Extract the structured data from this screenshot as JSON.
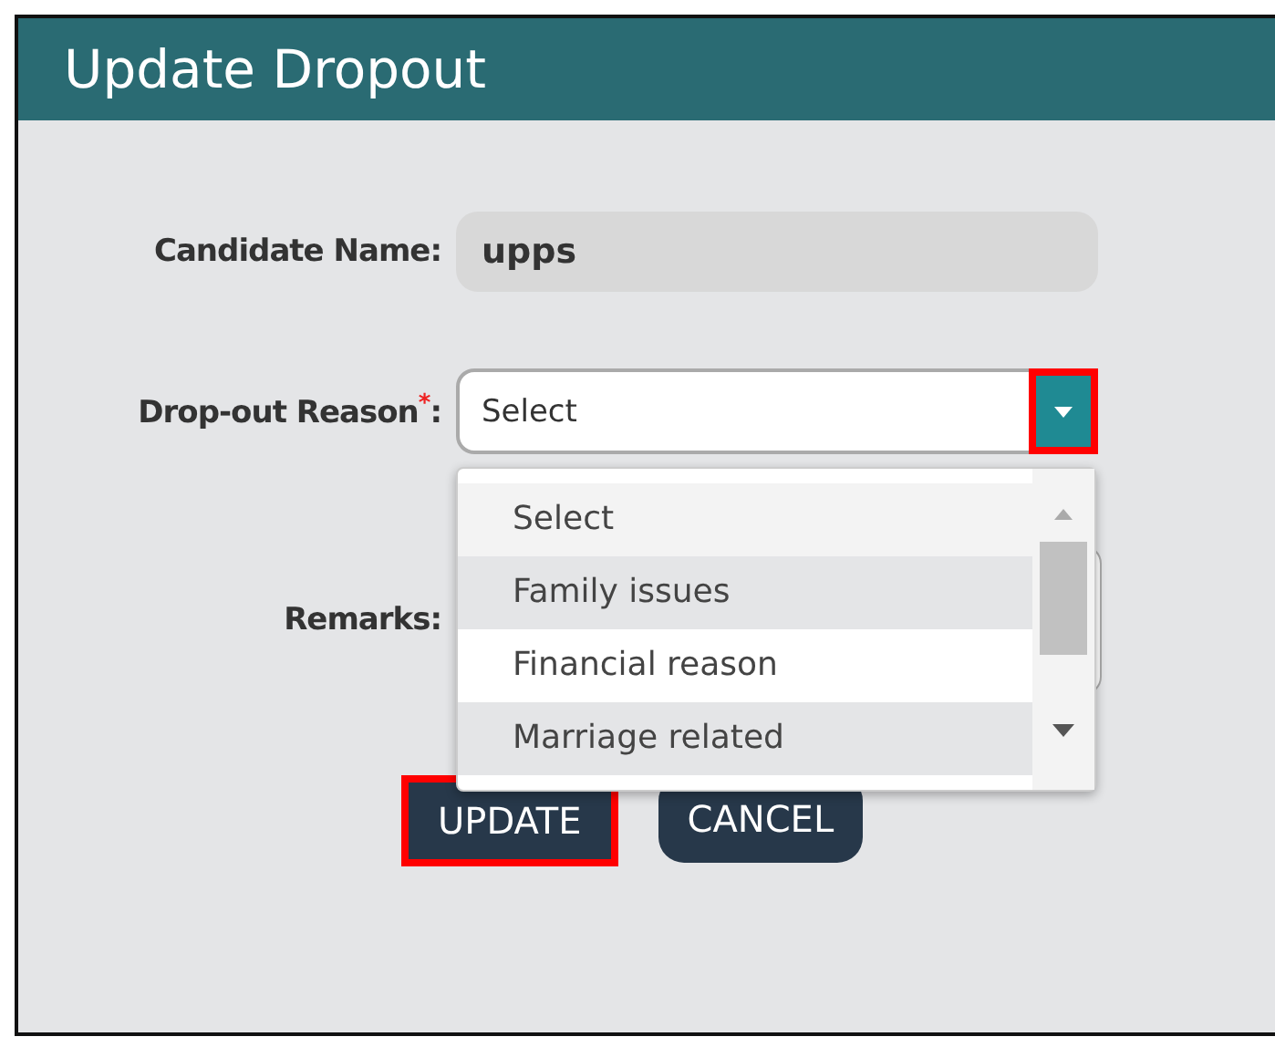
{
  "window": {
    "title": "Update Dropout"
  },
  "fields": [
    {
      "label": "Candidate Name:",
      "value": "upps"
    }
  ],
  "reason": {
    "label": "Drop-out Reason",
    "required_mark": "*",
    "colon": ":",
    "value": "Select",
    "toggle_highlighted": true,
    "options": [
      {
        "label": "Select",
        "selected": true
      },
      {
        "label": "Family issues",
        "selected": false
      },
      {
        "label": "Financial reason",
        "selected": false
      },
      {
        "label": "Marriage related",
        "selected": false
      }
    ]
  },
  "remarks": {
    "label": "Remarks:"
  },
  "buttons": [
    {
      "label": "UPDATE",
      "highlighted": true
    },
    {
      "label": "CANCEL",
      "highlighted": false
    }
  ]
}
